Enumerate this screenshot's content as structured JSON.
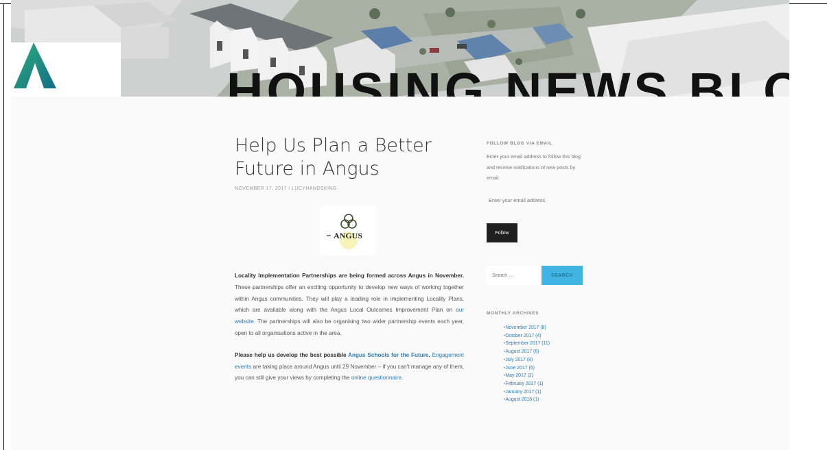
{
  "header": {
    "site_title": "HOUSING NEWS BLOG",
    "logo_icon": "angus-a-logo"
  },
  "post": {
    "title": "Help Us Plan a Better Future in Angus",
    "date": "NOVEMBER 17, 2017",
    "separator": " / ",
    "author": "LUCYHANDSKING",
    "image_text": "ANGUS",
    "p1_bold": "Locality Implementation Partnerships are being formed across Angus in November.",
    "p1_text": " These partnerships offer an exciting opportunity to develop new ways of working together within Angus communities. They will play a leading role in implementing Locality Plans, which are available along with the Angus Local Outcomes Improvement Plan on ",
    "p1_link": "our website",
    "p1_text2": ". The partnerships will also be organising two wider partnership events each year, open to all organisations active in the area.",
    "p2_bold": "Please help us develop the best possible ",
    "p2_link_bold": "Angus Schools for the Future",
    "p2_bold_end": ".",
    "p2_link": "Engagement events",
    "p2_text": " are taking place around Angus until 29 November – if you can't manage any of them, you can still give your views by completing the ",
    "p2_link2": "online questionnaire",
    "p2_end": "."
  },
  "sidebar": {
    "follow": {
      "title": "FOLLOW BLOG VIA EMAIL",
      "text": "Enter your email address to follow this blog and receive notifications of new posts by email.",
      "email_placeholder": "Enter your email address",
      "button": "Follow"
    },
    "search": {
      "placeholder": "Search …",
      "button": "SEARCH"
    },
    "archives": {
      "title": "MONTHLY ARCHIVES",
      "items": [
        "November 2017 (8)",
        "October 2017 (4)",
        "September 2017 (11)",
        "August 2017 (6)",
        "July 2017 (8)",
        "June 2017 (6)",
        "May 2017 (2)",
        "February 2017 (1)",
        "January 2017 (1)",
        "August 2016 (1)"
      ]
    }
  },
  "colors": {
    "link": "#2b7bb9",
    "search_button": "#41b4e3",
    "follow_button": "#1f1f1f",
    "logo_green": "#1e9a6d"
  }
}
